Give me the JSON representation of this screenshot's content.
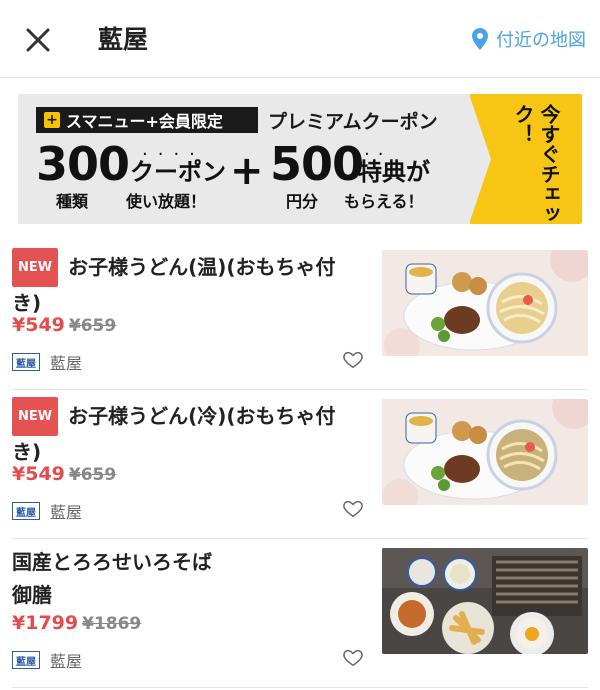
{
  "header": {
    "title": "藍屋",
    "map_link": "付近の地図"
  },
  "banner": {
    "tag": "スマニュー+会員限定",
    "heading": "プレミアムクーポン",
    "num1": "300",
    "num1_sub": "種類",
    "coupon_word": "クーポン",
    "unlimited": "使い放題！",
    "plus": "+",
    "num2": "500",
    "num2_sub": "円分",
    "tokuten": "特典が",
    "moraeru": "もらえる！",
    "cta": "今すぐチェック！"
  },
  "items": [
    {
      "badge": "NEW",
      "name": "お子様うどん(温)(おもちゃ付き)",
      "price": "¥549",
      "old_price": "¥659",
      "shop": "藍屋",
      "shop_logo": "藍屋"
    },
    {
      "badge": "NEW",
      "name": "お子様うどん(冷)(おもちゃ付き)",
      "price": "¥549",
      "old_price": "¥659",
      "shop": "藍屋",
      "shop_logo": "藍屋"
    },
    {
      "badge": "",
      "name": "国産とろろせいろそば御膳",
      "price": "¥1799",
      "old_price": "¥1869",
      "shop": "藍屋",
      "shop_logo": "藍屋"
    }
  ],
  "colors": {
    "accent_blue": "#4aa3e6",
    "price_red": "#e74a4a",
    "badge_red": "#e55252",
    "banner_yellow": "#f7c614"
  }
}
